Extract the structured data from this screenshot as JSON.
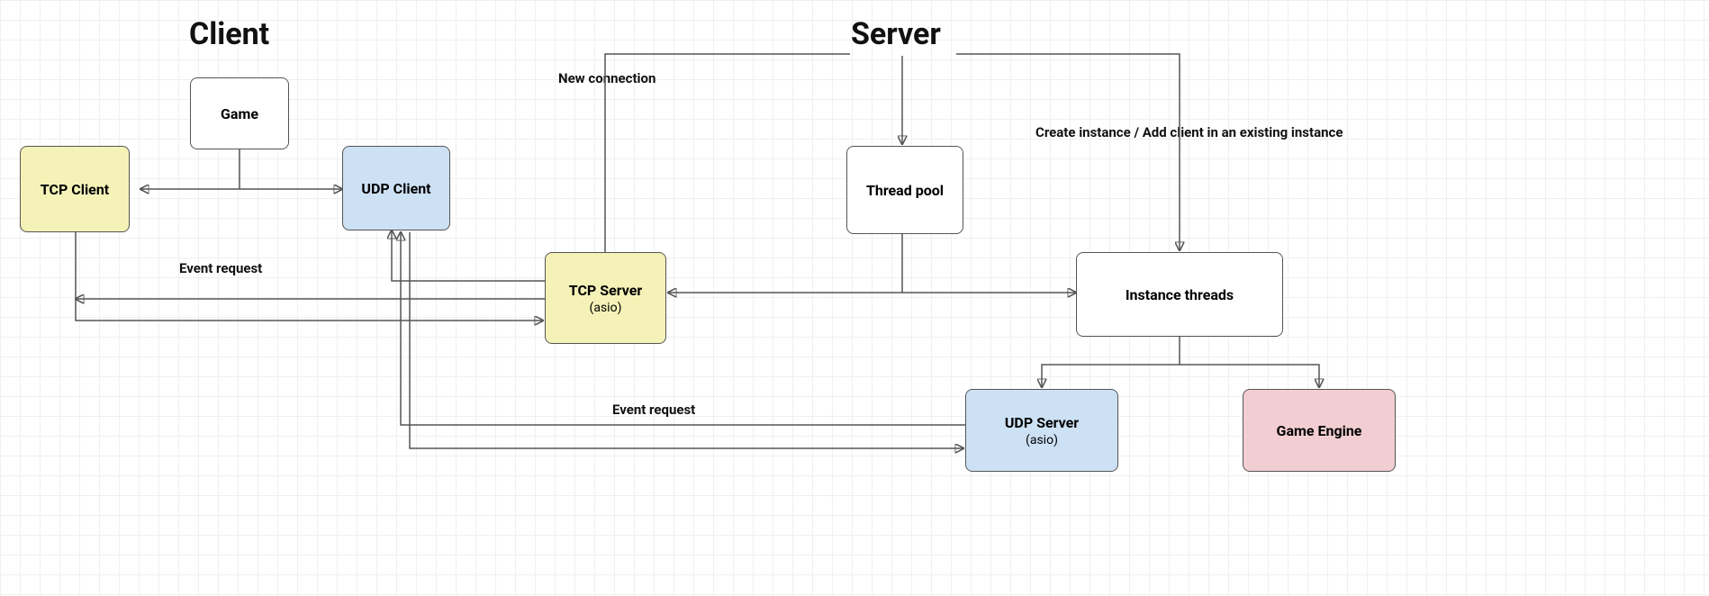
{
  "titles": {
    "client": "Client",
    "server": "Server"
  },
  "nodes": {
    "game": {
      "name": "Game"
    },
    "tcp_client": {
      "name": "TCP Client"
    },
    "udp_client": {
      "name": "UDP Client"
    },
    "tcp_server": {
      "name": "TCP Server",
      "sub": "(asio)"
    },
    "thread_pool": {
      "name": "Thread pool"
    },
    "instance_threads": {
      "name": "Instance threads"
    },
    "udp_server": {
      "name": "UDP Server",
      "sub": "(asio)"
    },
    "game_engine": {
      "name": "Game Engine"
    }
  },
  "labels": {
    "new_connection": "New connection",
    "event_request_1": "Event request",
    "event_request_2": "Event request",
    "create_instance": "Create instance / Add client in an existing instance"
  }
}
